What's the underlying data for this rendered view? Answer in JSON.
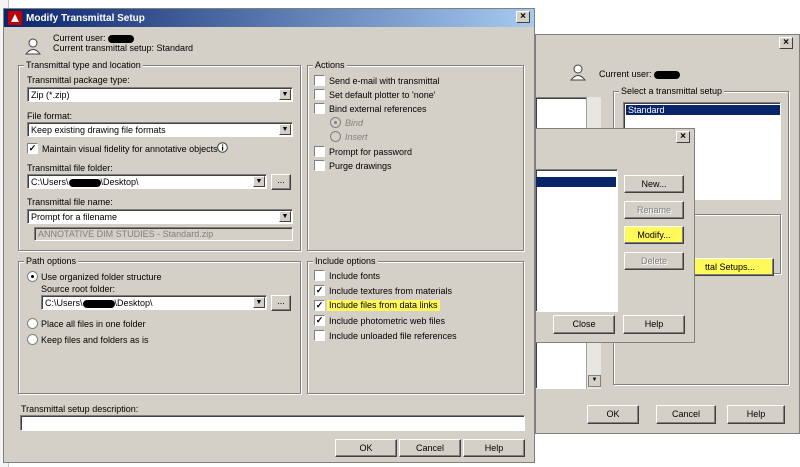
{
  "back_window": {
    "current_user_label": "Current user:",
    "select_setup_label": "Select a transmittal setup",
    "setup_list": [
      "Standard"
    ],
    "transmittal_setups_button": "ttal Setups...",
    "ok": "OK",
    "cancel": "Cancel",
    "help": "Help"
  },
  "middle_window": {
    "new_button": "New...",
    "rename_button": "Rename",
    "modify_button": "Modify...",
    "delete_button": "Delete",
    "close_button": "Close",
    "help_button": "Help"
  },
  "main": {
    "title": "Modify Transmittal Setup",
    "current_user_label": "Current user:",
    "current_setup": "Current transmittal setup: Standard",
    "type_location": {
      "group_title": "Transmittal type and location",
      "package_type_label": "Transmittal package type:",
      "package_type_value": "Zip (*.zip)",
      "file_format_label": "File format:",
      "file_format_value": "Keep existing drawing file formats",
      "maintain_fidelity_label": "Maintain visual fidelity for annotative objects",
      "folder_label": "Transmittal file folder:",
      "folder_value_prefix": "C:\\Users\\",
      "folder_value_suffix": "\\Desktop\\",
      "browse": "...",
      "file_name_label": "Transmittal file name:",
      "file_name_value": "Prompt for a filename",
      "file_name_preview": "ANNOTATIVE DIM STUDIES - Standard.zip"
    },
    "actions": {
      "group_title": "Actions",
      "send_email": "Send e-mail with transmittal",
      "set_plotter": "Set default plotter to 'none'",
      "bind_xrefs": "Bind external references",
      "bind": "Bind",
      "insert": "Insert",
      "prompt_password": "Prompt for password",
      "purge": "Purge drawings"
    },
    "path_options": {
      "group_title": "Path options",
      "use_organized": "Use organized folder structure",
      "source_root_label": "Source root folder:",
      "source_root_prefix": "C:\\Users\\",
      "source_root_suffix": "\\Desktop\\",
      "browse": "...",
      "place_all": "Place all files in one folder",
      "keep_as_is": "Keep files and folders as is"
    },
    "include_options": {
      "group_title": "Include options",
      "fonts": "Include fonts",
      "textures": "Include textures from materials",
      "data_links": "Include files from data links",
      "photometric": "Include photometric web files",
      "unloaded": "Include unloaded file references"
    },
    "description_label": "Transmittal setup description:",
    "description_value": "",
    "ok": "OK",
    "cancel": "Cancel",
    "help": "Help"
  },
  "colors": {
    "dialog_bg": "#d4d0c8",
    "title_active": "#0a246a",
    "selection": "#0a246a",
    "highlight": "#fff95a"
  }
}
